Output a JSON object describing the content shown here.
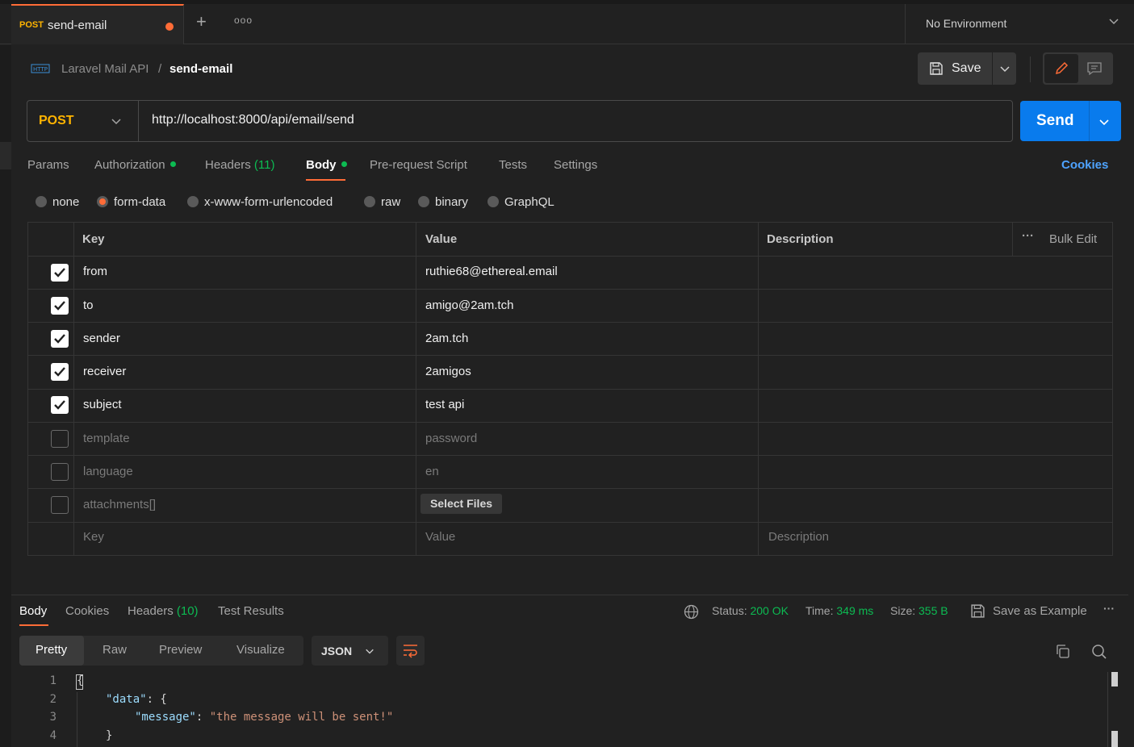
{
  "tab": {
    "method": "POST",
    "name": "send-email"
  },
  "environment": "No Environment",
  "breadcrumb": {
    "collection": "Laravel Mail API",
    "separator": "/",
    "request": "send-email"
  },
  "toolbar": {
    "save_label": "Save"
  },
  "request": {
    "method": "POST",
    "url": "http://localhost:8000/api/email/send",
    "send_label": "Send"
  },
  "request_tabs": {
    "params": "Params",
    "authorization": "Authorization",
    "headers": "Headers",
    "headers_count": "(11)",
    "body": "Body",
    "pre_request": "Pre-request Script",
    "tests": "Tests",
    "settings": "Settings",
    "cookies": "Cookies"
  },
  "body_types": {
    "none": "none",
    "form_data": "form-data",
    "urlencoded": "x-www-form-urlencoded",
    "raw": "raw",
    "binary": "binary",
    "graphql": "GraphQL",
    "selected": "form-data"
  },
  "table": {
    "headers": {
      "key": "Key",
      "value": "Value",
      "description": "Description",
      "bulk_edit": "Bulk Edit"
    },
    "rows": [
      {
        "checked": true,
        "key": "from",
        "value": "ruthie68@ethereal.email"
      },
      {
        "checked": true,
        "key": "to",
        "value": "amigo@2am.tch"
      },
      {
        "checked": true,
        "key": "sender",
        "value": "2am.tch"
      },
      {
        "checked": true,
        "key": "receiver",
        "value": "2amigos"
      },
      {
        "checked": true,
        "key": "subject",
        "value": "test api"
      },
      {
        "checked": false,
        "key": "template",
        "value": "password"
      },
      {
        "checked": false,
        "key": "language",
        "value": "en"
      },
      {
        "checked": false,
        "key": "attachments[]",
        "value": "Select Files"
      }
    ],
    "placeholders": {
      "key": "Key",
      "value": "Value",
      "description": "Description"
    }
  },
  "response": {
    "tabs": {
      "body": "Body",
      "cookies": "Cookies",
      "headers": "Headers",
      "headers_count": "(10)",
      "test_results": "Test Results"
    },
    "status_label": "Status:",
    "status": "200 OK",
    "time_label": "Time:",
    "time": "349 ms",
    "size_label": "Size:",
    "size": "355 B",
    "save_example": "Save as Example",
    "formats": {
      "pretty": "Pretty",
      "raw": "Raw",
      "preview": "Preview",
      "visualize": "Visualize"
    },
    "language": "JSON",
    "lines": [
      "1",
      "2",
      "3",
      "4"
    ],
    "code": {
      "open": "{",
      "data_key": "\"data\"",
      "data_sep": ": {",
      "msg_key": "\"message\"",
      "msg_sep": ": ",
      "msg_val": "\"the message will be sent!\"",
      "close": "}"
    }
  },
  "colors": {
    "accent": "#ff6c37",
    "send": "#097bed",
    "post": "#ffb400",
    "ok": "#0cbb52",
    "link": "#4ea3ff"
  }
}
